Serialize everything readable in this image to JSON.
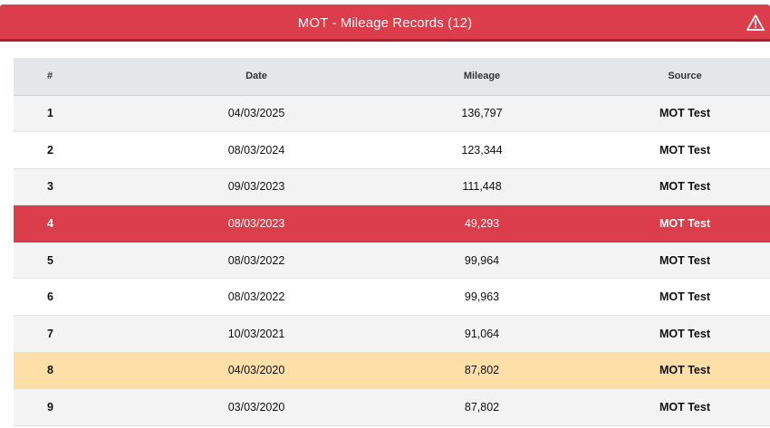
{
  "header": {
    "title": "MOT - Mileage Records (12)",
    "icon": "warning-triangle-icon",
    "color": "#dc3d4a"
  },
  "table": {
    "columns": [
      "#",
      "Date",
      "Mileage",
      "Source"
    ],
    "rows": [
      {
        "num": "1",
        "date": "04/03/2025",
        "mileage": "136,797",
        "source": "MOT Test",
        "status": "normal"
      },
      {
        "num": "2",
        "date": "08/03/2024",
        "mileage": "123,344",
        "source": "MOT Test",
        "status": "normal"
      },
      {
        "num": "3",
        "date": "09/03/2023",
        "mileage": "111,448",
        "source": "MOT Test",
        "status": "normal"
      },
      {
        "num": "4",
        "date": "08/03/2023",
        "mileage": "49,293",
        "source": "MOT Test",
        "status": "discrepancy"
      },
      {
        "num": "5",
        "date": "08/03/2022",
        "mileage": "99,964",
        "source": "MOT Test",
        "status": "normal"
      },
      {
        "num": "6",
        "date": "08/03/2022",
        "mileage": "99,963",
        "source": "MOT Test",
        "status": "normal"
      },
      {
        "num": "7",
        "date": "10/03/2021",
        "mileage": "91,064",
        "source": "MOT Test",
        "status": "normal"
      },
      {
        "num": "8",
        "date": "04/03/2020",
        "mileage": "87,802",
        "source": "MOT Test",
        "status": "warning"
      },
      {
        "num": "9",
        "date": "03/03/2020",
        "mileage": "87,802",
        "source": "MOT Test",
        "status": "normal"
      }
    ]
  },
  "colors": {
    "discrepancy_row": "#dc3d4a",
    "warning_row": "#ffdfa8",
    "stripe_row": "#f3f3f3"
  }
}
